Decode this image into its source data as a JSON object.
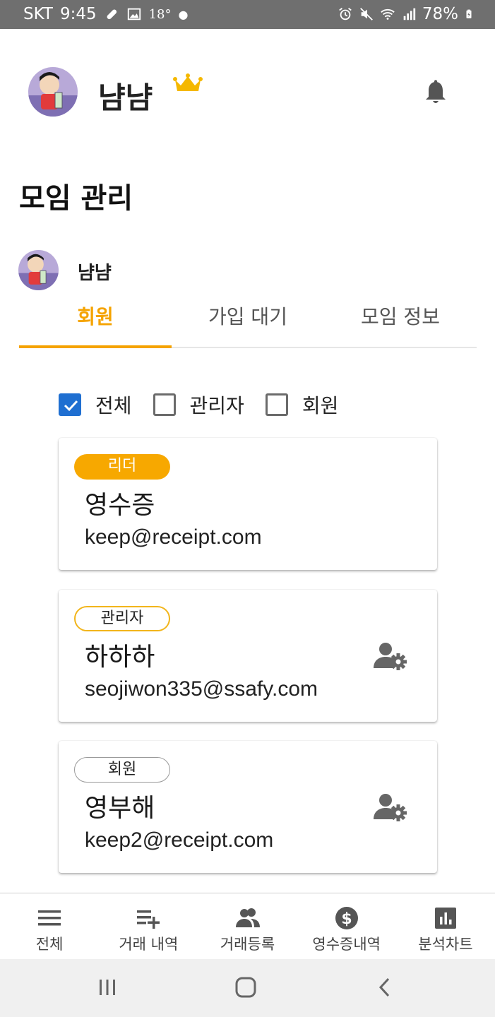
{
  "status_bar": {
    "carrier": "SKT",
    "time": "9:45",
    "temperature": "18°",
    "battery": "78%"
  },
  "header": {
    "user_name": "냠냠",
    "crown_color": "#f5b800"
  },
  "page": {
    "title": "모임 관리"
  },
  "group": {
    "name": "냠냠"
  },
  "tabs": [
    {
      "label": "회원",
      "active": true
    },
    {
      "label": "가입 대기",
      "active": false
    },
    {
      "label": "모임 정보",
      "active": false
    }
  ],
  "filters": [
    {
      "label": "전체",
      "checked": true
    },
    {
      "label": "관리자",
      "checked": false
    },
    {
      "label": "회원",
      "checked": false
    }
  ],
  "members": [
    {
      "role": "리더",
      "name": "영수증",
      "email": "keep@receipt.com",
      "has_settings": false
    },
    {
      "role": "관리자",
      "name": "하하하",
      "email": "seojiwon335@ssafy.com",
      "has_settings": true
    },
    {
      "role": "회원",
      "name": "영부해",
      "email": "keep2@receipt.com",
      "has_settings": true
    }
  ],
  "bottom_nav": [
    {
      "label": "전체",
      "icon": "menu-icon"
    },
    {
      "label": "거래 내역",
      "icon": "playlist-add-icon"
    },
    {
      "label": "거래등록",
      "icon": "people-icon"
    },
    {
      "label": "영수증내역",
      "icon": "dollar-circle-icon"
    },
    {
      "label": "분석차트",
      "icon": "bar-chart-icon"
    }
  ],
  "colors": {
    "accent": "#f5a300",
    "checkbox": "#1f6fd1",
    "icon_gray": "#666666"
  }
}
